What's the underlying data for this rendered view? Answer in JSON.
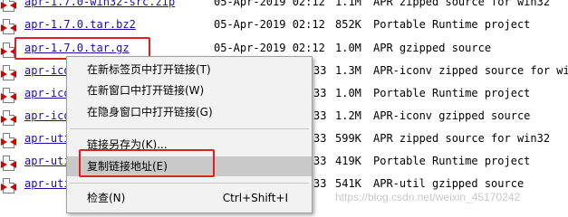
{
  "listing": {
    "rows": [
      {
        "name": "apr-1.7.0-win32-src.zip",
        "date": "05-Apr-2019 02:12",
        "size": "1.1M",
        "desc": "APR zipped source for win32"
      },
      {
        "name": "apr-1.7.0.tar.bz2",
        "date": "05-Apr-2019 02:12",
        "size": "852K",
        "desc": "Portable Runtime project"
      },
      {
        "name": "apr-1.7.0.tar.gz",
        "date": "05-Apr-2019 02:12",
        "size": "1.0M",
        "desc": "APR gzipped source"
      },
      {
        "name": "apr-ico",
        "date": "33",
        "size": "1.3M",
        "desc": "APR-iconv zipped source for win32"
      },
      {
        "name": "apr-ico",
        "date": "33",
        "size": "1.0M",
        "desc": "Portable Runtime project"
      },
      {
        "name": "apr-ico",
        "date": "33",
        "size": "1.2M",
        "desc": "APR-iconv gzipped source"
      },
      {
        "name": "apr-uti",
        "date": "33",
        "size": "599K",
        "desc": "APR zipped source for win32"
      },
      {
        "name": "apr-uti",
        "date": "33",
        "size": "419K",
        "desc": "Portable Runtime project"
      },
      {
        "name": "apr-uti",
        "date": "33",
        "size": "541K",
        "desc": "APR-util gzipped source"
      }
    ]
  },
  "context_menu": {
    "items": [
      {
        "label": "在新标签页中打开链接(T)",
        "shortcut": ""
      },
      {
        "label": "在新窗口中打开链接(W)",
        "shortcut": ""
      },
      {
        "label": "在隐身窗口中打开链接(G)",
        "shortcut": ""
      },
      {
        "label": "链接另存为(K)...",
        "shortcut": ""
      },
      {
        "label": "复制链接地址(E)",
        "shortcut": ""
      },
      {
        "label": "检查(N)",
        "shortcut": "Ctrl+Shift+I"
      }
    ]
  },
  "watermark": "https://blog.csdn.net/weixin_45170242",
  "colors": {
    "link": "#1a0dab",
    "highlight_box": "#e02020",
    "menu_hover": "#c9c9c9"
  }
}
